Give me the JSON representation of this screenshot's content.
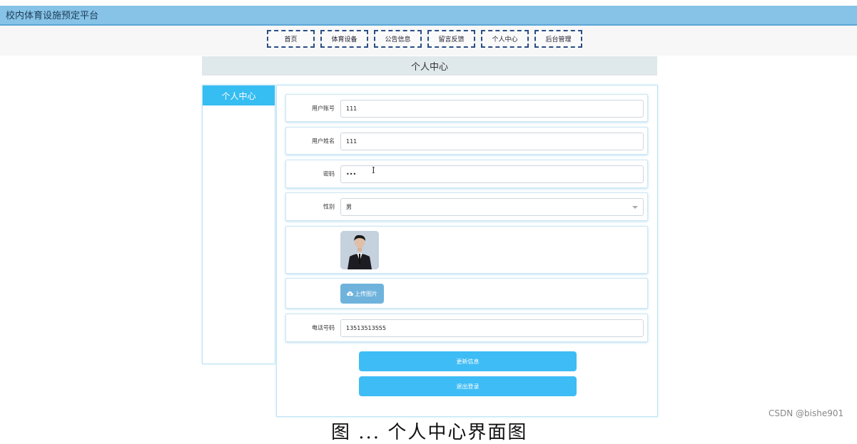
{
  "app": {
    "title": "校内体育设施预定平台"
  },
  "nav": {
    "items": [
      "首页",
      "体育设备",
      "公告信息",
      "留言反馈",
      "个人中心",
      "后台管理"
    ]
  },
  "page": {
    "heading": "个人中心"
  },
  "sidebar": {
    "items": [
      {
        "label": "个人中心",
        "active": true
      }
    ]
  },
  "form": {
    "account": {
      "label": "用户账号",
      "value": "111"
    },
    "name": {
      "label": "用户姓名",
      "value": "111"
    },
    "password": {
      "label": "密码",
      "value": "•••"
    },
    "gender": {
      "label": "性别",
      "value": "男"
    },
    "upload_label": "上传图片",
    "phone": {
      "label": "电话号码",
      "value": "13513513555"
    }
  },
  "actions": {
    "update": "更新信息",
    "logout": "退出登录"
  },
  "watermark": "CSDN @bishe901",
  "caption": "图 ... 个人中心界面图",
  "colors": {
    "topbar": "#86c3e6",
    "accent": "#3ebcf5",
    "nav_border": "#2a4e84"
  }
}
